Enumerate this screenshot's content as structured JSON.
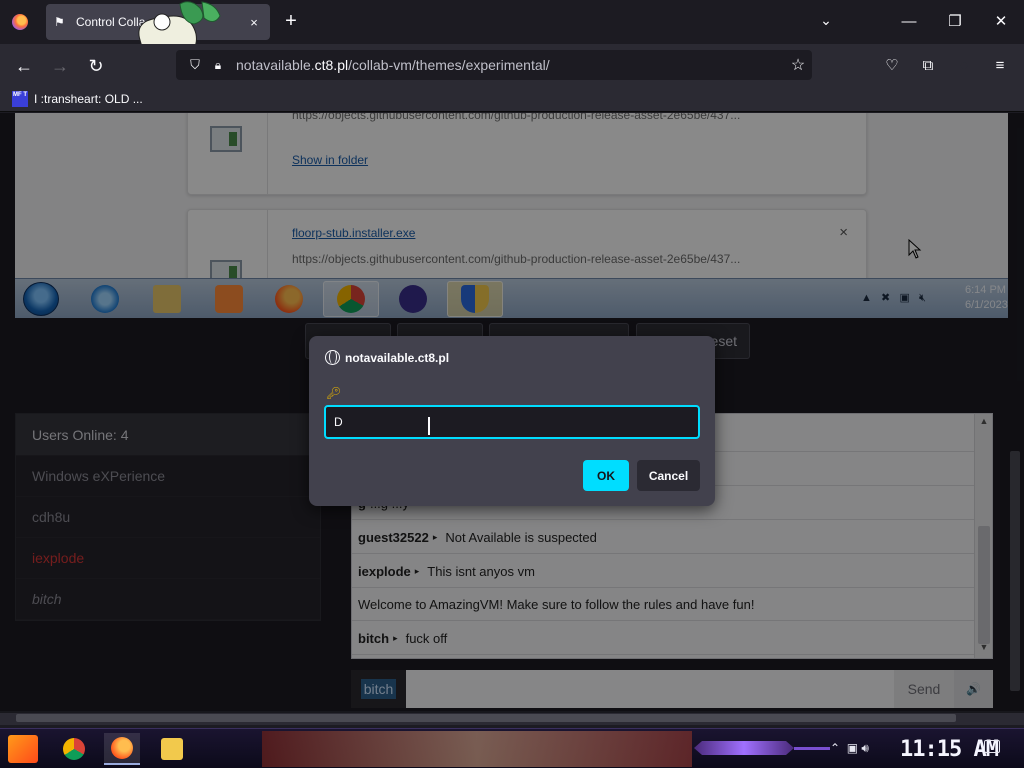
{
  "browser": {
    "tab": {
      "title": "Control Colla... - irtual",
      "close": "×"
    },
    "new_tab": "+",
    "url": {
      "domain": "notavailable.",
      "domain_bold": "ct8.pl",
      "path": "/collab-vm/themes/experimental/"
    },
    "bookmarks": [
      {
        "icon_text": "MF T",
        "label": "I :transheart: OLD ..."
      }
    ]
  },
  "vm": {
    "downloads": [
      {
        "name": "",
        "url": "https://objects.githubusercontent.com/github-production-release-asset-2e65be/437...",
        "action": "Show in folder"
      },
      {
        "name": "floorp-stub.installer.exe",
        "url": "https://objects.githubusercontent.com/github-production-release-asset-2e65be/437...",
        "close": "×"
      }
    ],
    "clock": {
      "time": "6:14 PM",
      "date": "6/1/2023"
    }
  },
  "vm_buttons": [
    {
      "label": ""
    },
    {
      "label": ""
    },
    {
      "label": ""
    },
    {
      "label": "eset"
    }
  ],
  "users": {
    "header": "Users Online: 4",
    "list": [
      {
        "name": "Windows eXPerience",
        "style": "normal"
      },
      {
        "name": "cdh8u",
        "style": "normal"
      },
      {
        "name": "iexplode",
        "style": "red"
      },
      {
        "name": "bitch",
        "style": "italic"
      }
    ]
  },
  "chat": {
    "messages": [
      {
        "user": "",
        "text": ""
      },
      {
        "user": "",
        "text": ""
      },
      {
        "user": "g",
        "text": "...g ...y"
      },
      {
        "user": "guest32522",
        "text": "Not Available is suspected"
      },
      {
        "user": "iexplode",
        "text": "This isnt anyos vm"
      },
      {
        "user": "",
        "text": "Welcome to AmazingVM! Make sure to follow the rules and have fun!"
      },
      {
        "user": "bitch",
        "text": "fuck off"
      }
    ],
    "username": "bitch",
    "send_label": "Send",
    "volume_icon": "🔊"
  },
  "dialog": {
    "origin": "notavailable.ct8.pl",
    "input_value": "D",
    "ok_label": "OK",
    "cancel_label": "Cancel"
  },
  "host_taskbar": {
    "clock": "11:15 AM"
  },
  "colors": {
    "accent": "#00ddff",
    "chrome_bg": "#2b2a33",
    "dialog_bg": "#42414d"
  }
}
